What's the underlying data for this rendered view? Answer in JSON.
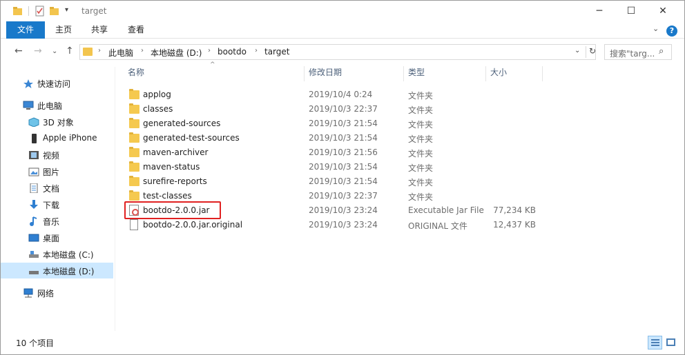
{
  "window": {
    "title": "target",
    "controls": {
      "minimize": "─",
      "maximize": "☐",
      "close": "✕"
    }
  },
  "ribbon": {
    "tabs": [
      "文件",
      "主页",
      "共享",
      "查看"
    ],
    "help": "?"
  },
  "address": {
    "crumbs": [
      "此电脑",
      "本地磁盘 (D:)",
      "bootdo",
      "target"
    ],
    "search_placeholder": "搜索\"targ..."
  },
  "nav_pane": {
    "items": [
      {
        "label": "快速访问",
        "icon": "star-icon"
      },
      {
        "label": "此电脑",
        "icon": "computer-icon"
      },
      {
        "label": "3D 对象",
        "icon": "cube-icon"
      },
      {
        "label": "Apple iPhone",
        "icon": "phone-icon"
      },
      {
        "label": "视频",
        "icon": "video-icon"
      },
      {
        "label": "图片",
        "icon": "picture-icon"
      },
      {
        "label": "文档",
        "icon": "document-icon"
      },
      {
        "label": "下载",
        "icon": "download-icon"
      },
      {
        "label": "音乐",
        "icon": "music-icon"
      },
      {
        "label": "桌面",
        "icon": "desktop-icon"
      },
      {
        "label": "本地磁盘 (C:)",
        "icon": "drive-icon"
      },
      {
        "label": "本地磁盘 (D:)",
        "icon": "drive-icon",
        "selected": true
      },
      {
        "label": "网络",
        "icon": "network-icon"
      }
    ]
  },
  "file_list": {
    "columns": {
      "name": "名称",
      "date": "修改日期",
      "type": "类型",
      "size": "大小"
    },
    "rows": [
      {
        "name": "applog",
        "date": "2019/10/4 0:24",
        "type": "文件夹",
        "size": "",
        "icon": "folder-icon"
      },
      {
        "name": "classes",
        "date": "2019/10/3 22:37",
        "type": "文件夹",
        "size": "",
        "icon": "folder-icon"
      },
      {
        "name": "generated-sources",
        "date": "2019/10/3 21:54",
        "type": "文件夹",
        "size": "",
        "icon": "folder-icon"
      },
      {
        "name": "generated-test-sources",
        "date": "2019/10/3 21:54",
        "type": "文件夹",
        "size": "",
        "icon": "folder-icon"
      },
      {
        "name": "maven-archiver",
        "date": "2019/10/3 21:56",
        "type": "文件夹",
        "size": "",
        "icon": "folder-icon"
      },
      {
        "name": "maven-status",
        "date": "2019/10/3 21:54",
        "type": "文件夹",
        "size": "",
        "icon": "folder-icon"
      },
      {
        "name": "surefire-reports",
        "date": "2019/10/3 21:54",
        "type": "文件夹",
        "size": "",
        "icon": "folder-icon"
      },
      {
        "name": "test-classes",
        "date": "2019/10/3 22:37",
        "type": "文件夹",
        "size": "",
        "icon": "folder-icon"
      },
      {
        "name": "bootdo-2.0.0.jar",
        "date": "2019/10/3 23:24",
        "type": "Executable Jar File",
        "size": "77,234 KB",
        "icon": "jar-file-icon",
        "highlighted": true
      },
      {
        "name": "bootdo-2.0.0.jar.original",
        "date": "2019/10/3 23:24",
        "type": "ORIGINAL 文件",
        "size": "12,437 KB",
        "icon": "file-icon"
      }
    ]
  },
  "status": {
    "item_count": "10 个项目"
  },
  "colors": {
    "accent": "#1979ca",
    "selection": "#cce8ff",
    "highlight_box": "#e02020",
    "folder": "#f5c94f"
  }
}
